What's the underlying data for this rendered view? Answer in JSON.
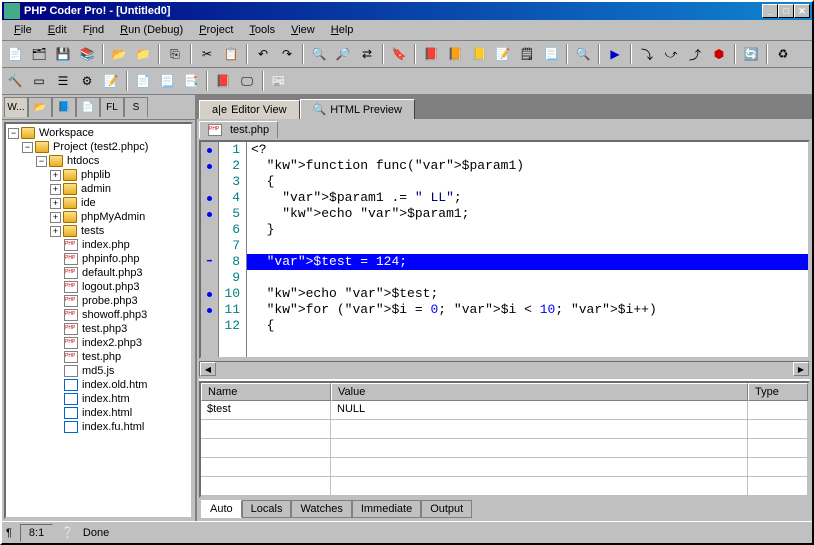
{
  "titlebar": {
    "text": "PHP Coder Pro! - [Untitled0]"
  },
  "menu": [
    "File",
    "Edit",
    "Find",
    "Run (Debug)",
    "Project",
    "Tools",
    "View",
    "Help"
  ],
  "sidebar_tabs": [
    "W...",
    "📂",
    "📘",
    "📄",
    "FL",
    "S"
  ],
  "tree": {
    "root": "Workspace",
    "project": "Project (test2.phpc)",
    "htdocs": "htdocs",
    "folders": [
      "phplib",
      "admin",
      "ide",
      "phpMyAdmin",
      "tests"
    ],
    "files": [
      "index.php",
      "phpinfo.php",
      "default.php3",
      "logout.php3",
      "probe.php3",
      "showoff.php3",
      "test.php3",
      "index2.php3",
      "test.php",
      "md5.js",
      "index.old.htm",
      "index.htm",
      "index.html",
      "index.fu.html"
    ]
  },
  "editor_tabs": [
    {
      "label": "Editor View",
      "active": true
    },
    {
      "label": "HTML Preview",
      "active": false
    }
  ],
  "file_tab": "test.php",
  "code": {
    "lines": [
      "<?",
      "  function func($param1)",
      "  {",
      "    $param1 .= \" LL\";",
      "    echo $param1;",
      "  }",
      "",
      "  $test = 124;",
      "",
      "  echo $test;",
      "  for ($i = 0; $i < 10; $i++)",
      "  {"
    ],
    "highlight_line": 8
  },
  "watch": {
    "headers": [
      "Name",
      "Value",
      "Type"
    ],
    "rows": [
      {
        "name": "$test",
        "value": "NULL",
        "type": ""
      }
    ],
    "tabs": [
      "Auto",
      "Locals",
      "Watches",
      "Immediate",
      "Output"
    ]
  },
  "statusbar": {
    "pos": "8:1",
    "msg": "Done"
  }
}
